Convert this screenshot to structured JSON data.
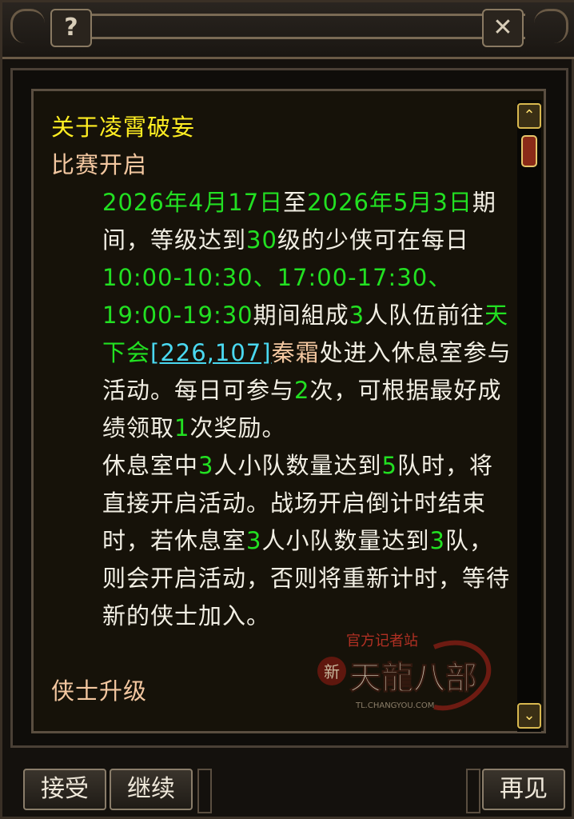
{
  "window": {
    "help_icon": "?",
    "close_icon": "✕"
  },
  "content": {
    "title": "关于凌霄破妄",
    "section1": "比赛开启",
    "p1": {
      "d1": "2026年4月17日",
      "t1": "至",
      "d2": "2026年5月3日",
      "t2": "期间，等级达到",
      "lvl": "30",
      "t3": "级的少侠可在每日",
      "times": "10:00-10:30、17:00-17:30、19:00-19:30",
      "t4": "期间組成",
      "n1": "3",
      "t5": "人队伍前往",
      "place": "天下会",
      "coords": "[226,107]",
      "npc": "秦霜",
      "t6": "处进入休息室参与活动。每日可参与",
      "n2": "2",
      "t7": "次，可根据最好成绩领取",
      "n3": "1",
      "t8": "次奖励。"
    },
    "p2": {
      "t1": "休息室中",
      "n1": "3",
      "t2": "人小队数量达到",
      "n2": "5",
      "t3": "队时，将直接开启活动。战场开启倒计时结束时，若休息室",
      "n3": "3",
      "t4": "人小队数量达到",
      "n4": "3",
      "t5": "队，则会开启活动，否则将重新计时，等待新的侠士加入。"
    },
    "section2": "侠士升级"
  },
  "watermark": {
    "line1": "官方记者站",
    "line2": "新",
    "line3": "天龍八部",
    "line4": "TL.CHANGYOU.COM"
  },
  "buttons": {
    "accept": "接受",
    "continue": "继续",
    "goodbye": "再见"
  },
  "colors": {
    "title": "#ffee22",
    "section": "#f3c7a0",
    "highlight": "#22e022",
    "link": "#4ad8f0",
    "text": "#f2efe4"
  }
}
